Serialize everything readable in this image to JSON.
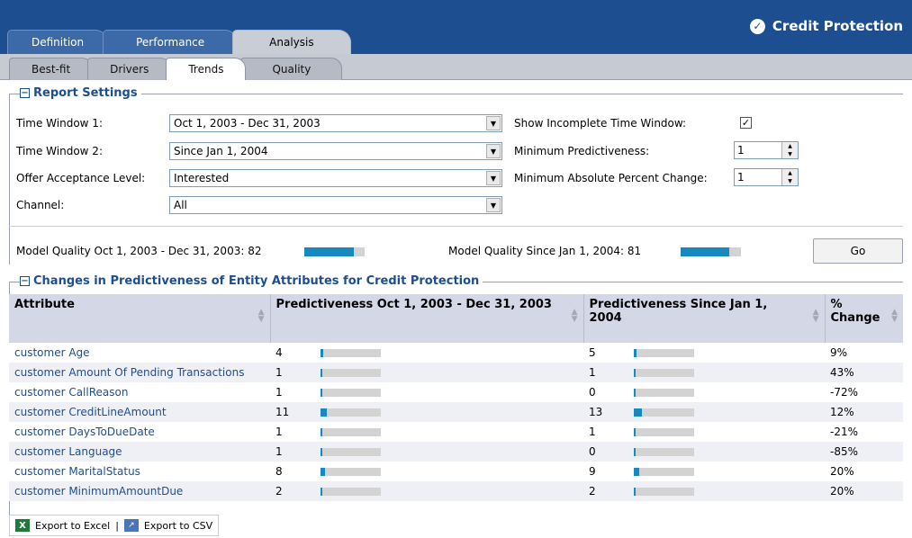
{
  "brand": {
    "title": "Credit Protection"
  },
  "top_tabs": [
    "Definition",
    "Performance",
    "Analysis"
  ],
  "sub_tabs": [
    "Best-fit",
    "Drivers",
    "Trends",
    "Quality"
  ],
  "settings": {
    "title": "Report Settings",
    "time_window_1_label": "Time Window 1:",
    "time_window_1_value": "Oct 1, 2003 - Dec 31, 2003",
    "time_window_2_label": "Time Window 2:",
    "time_window_2_value": "Since Jan 1, 2004",
    "offer_label": "Offer Acceptance Level:",
    "offer_value": "Interested",
    "channel_label": "Channel:",
    "channel_value": "All",
    "incomplete_label": "Show Incomplete Time Window:",
    "incomplete_checked": "✓",
    "min_pred_label": "Minimum Predictiveness:",
    "min_pred_value": "1",
    "min_abs_label": "Minimum Absolute Percent Change:",
    "min_abs_value": "1"
  },
  "quality": {
    "q1_label": "Model Quality Oct 1, 2003 - Dec 31, 2003: 82",
    "q1_value": 82,
    "q2_label": "Model Quality Since Jan 1, 2004: 81",
    "q2_value": 81,
    "go_label": "Go"
  },
  "changes": {
    "title": "Changes in Predictiveness of Entity Attributes for Credit Protection",
    "headers": [
      "Attribute",
      "Predictiveness Oct 1, 2003 - Dec 31, 2003",
      "Predictiveness Since Jan 1, 2004",
      "% Change"
    ],
    "rows": [
      {
        "attr": "customer Age",
        "p1": "4",
        "p2": "5",
        "change": "9%"
      },
      {
        "attr": "customer Amount Of Pending Transactions",
        "p1": "1",
        "p2": "1",
        "change": "43%"
      },
      {
        "attr": "customer CallReason",
        "p1": "1",
        "p2": "0",
        "change": "-72%"
      },
      {
        "attr": "customer CreditLineAmount",
        "p1": "11",
        "p2": "13",
        "change": "12%"
      },
      {
        "attr": "customer DaysToDueDate",
        "p1": "1",
        "p2": "1",
        "change": "-21%"
      },
      {
        "attr": "customer Language",
        "p1": "1",
        "p2": "0",
        "change": "-85%"
      },
      {
        "attr": "customer MaritalStatus",
        "p1": "8",
        "p2": "9",
        "change": "20%"
      },
      {
        "attr": "customer MinimumAmountDue",
        "p1": "2",
        "p2": "2",
        "change": "20%"
      }
    ]
  },
  "footer": {
    "excel": "Export to Excel",
    "separator": "|",
    "csv": "Export to CSV"
  },
  "colors": {
    "header_bg": "#1d4e8f",
    "bar_fill": "#1788c0",
    "bar_track": "#d3d3d3",
    "link": "#1d4e8f"
  }
}
